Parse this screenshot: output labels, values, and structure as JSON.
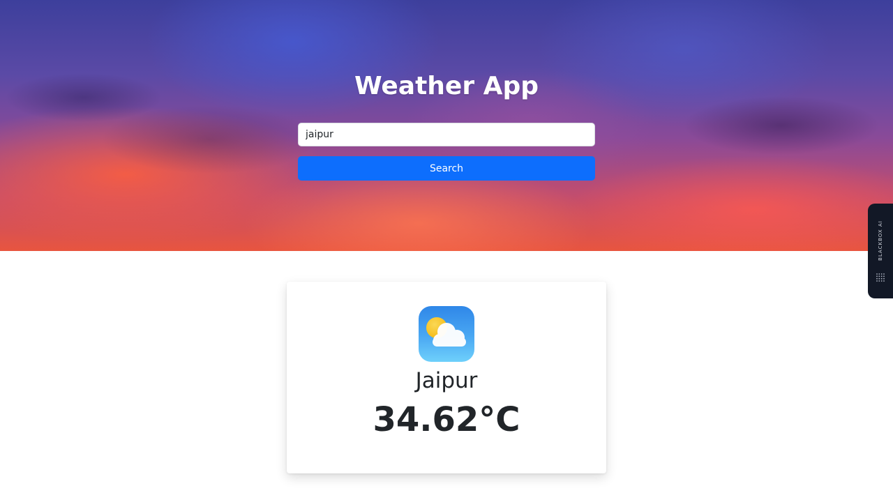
{
  "app": {
    "title": "Weather App"
  },
  "search": {
    "value": "jaipur",
    "button_label": "Search"
  },
  "weather": {
    "icon": "partly-cloudy-icon",
    "city": "Jaipur",
    "temperature": "34.62°C"
  },
  "side_tab": {
    "label": "BLACKBOX AI",
    "icon": "blackbox-logo-icon"
  },
  "colors": {
    "button": "#0d6efd",
    "text": "#212529",
    "side_tab_bg": "#121826"
  }
}
